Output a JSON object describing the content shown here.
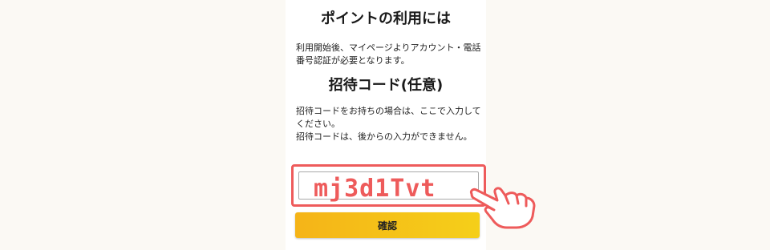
{
  "points": {
    "heading": "ポイントの利用には",
    "description": "利用開始後、マイページよりアカウント・電話番号認証が必要となります。"
  },
  "invite": {
    "heading": "招待コード(任意)",
    "description_line1": "招待コードをお持ちの場合は、ここで入力してください。",
    "description_line2": "招待コードは、後からの入力ができません。",
    "code_value": "mj3d1Tvt"
  },
  "confirm_button": {
    "label": "確認"
  },
  "icons": {
    "pointer": "pointing-hand-icon"
  },
  "colors": {
    "highlight": "#ee5b5b",
    "button_start": "#f5b418",
    "button_end": "#f5cf19"
  }
}
